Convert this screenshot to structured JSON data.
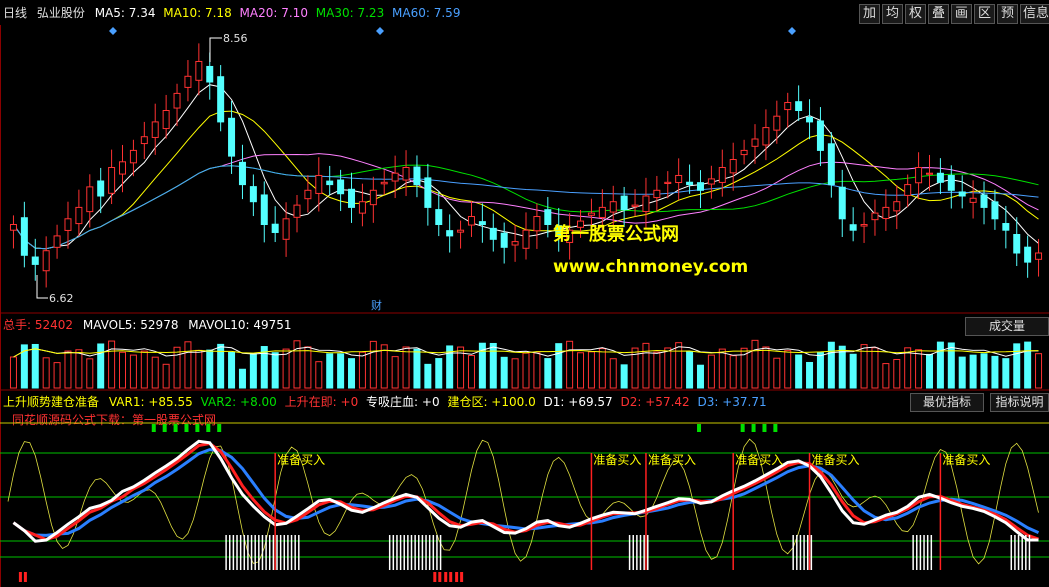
{
  "main_header": {
    "period": "日线",
    "name": "弘业股份",
    "ma5": "MA5: 7.34",
    "ma10": "MA10: 7.18",
    "ma20": "MA20: 7.10",
    "ma30": "MA30: 7.23",
    "ma60": "MA60: 7.59"
  },
  "toolbar": [
    "加",
    "均",
    "权",
    "叠",
    "画",
    "区",
    "预",
    "信息"
  ],
  "price_annotations": {
    "high": "8.56",
    "low": "6.62",
    "cai": "财"
  },
  "watermark": {
    "line1": "第一股票公式网",
    "line2": "www.chnmoney.com"
  },
  "volume_header": {
    "total": "总手: 52402",
    "mavol5": "MAVOL5: 52978",
    "mavol10": "MAVOL10: 49751",
    "button": "成交量"
  },
  "indicator_header": {
    "name": "上升顺势建仓准备",
    "var1": "VAR1: +85.55",
    "var2": "VAR2: +8.00",
    "up": "上升在即: +0",
    "zx": "专吸庄血: +0",
    "jc": "建仓区: +100.0",
    "d1": "D1: +69.57",
    "d2": "D2: +57.42",
    "d3": "D3: +37.71",
    "btn_best": "最优指标",
    "btn_help": "指标说明",
    "promo": "同花顺源码公式下载：第一股票公式网"
  },
  "buy_signals": [
    {
      "label": "准备买入"
    },
    {
      "label": "准备买入"
    },
    {
      "label": "准备买入"
    },
    {
      "label": "准备买入"
    },
    {
      "label": "准备买入"
    },
    {
      "label": "准备买入"
    }
  ],
  "colors": {
    "up": "#ff3232",
    "down": "#54ffff",
    "ma5": "#ffffff",
    "ma10": "#ffff00",
    "ma20": "#ff80ff",
    "ma30": "#00e000",
    "ma60": "#4aa0ff",
    "d1": "#ffffff",
    "d2": "#ff2020",
    "d3": "#2a7fff",
    "var": "#e0e040"
  },
  "chart_data": {
    "type": "candlestick",
    "price_range": [
      6.3,
      8.8
    ],
    "close": [
      7.05,
      6.78,
      6.7,
      6.82,
      6.95,
      7.1,
      7.2,
      7.38,
      7.3,
      7.55,
      7.6,
      7.7,
      7.82,
      7.95,
      8.05,
      8.2,
      8.35,
      8.48,
      8.3,
      7.95,
      7.65,
      7.4,
      7.25,
      7.05,
      6.98,
      7.1,
      7.22,
      7.35,
      7.48,
      7.4,
      7.32,
      7.2,
      7.25,
      7.35,
      7.42,
      7.5,
      7.55,
      7.4,
      7.2,
      7.05,
      6.95,
      7.0,
      7.12,
      7.05,
      6.92,
      6.85,
      6.9,
      7.0,
      7.12,
      7.05,
      6.95,
      7.0,
      7.08,
      7.15,
      7.2,
      7.25,
      7.18,
      7.22,
      7.3,
      7.35,
      7.42,
      7.48,
      7.4,
      7.35,
      7.45,
      7.55,
      7.62,
      7.7,
      7.8,
      7.9,
      8.0,
      8.12,
      8.05,
      7.95,
      7.7,
      7.4,
      7.1,
      7.0,
      7.05,
      7.15,
      7.2,
      7.25,
      7.4,
      7.55,
      7.5,
      7.42,
      7.35,
      7.3,
      7.28,
      7.2,
      7.1,
      7.0,
      6.8,
      6.72,
      6.8
    ]
  }
}
